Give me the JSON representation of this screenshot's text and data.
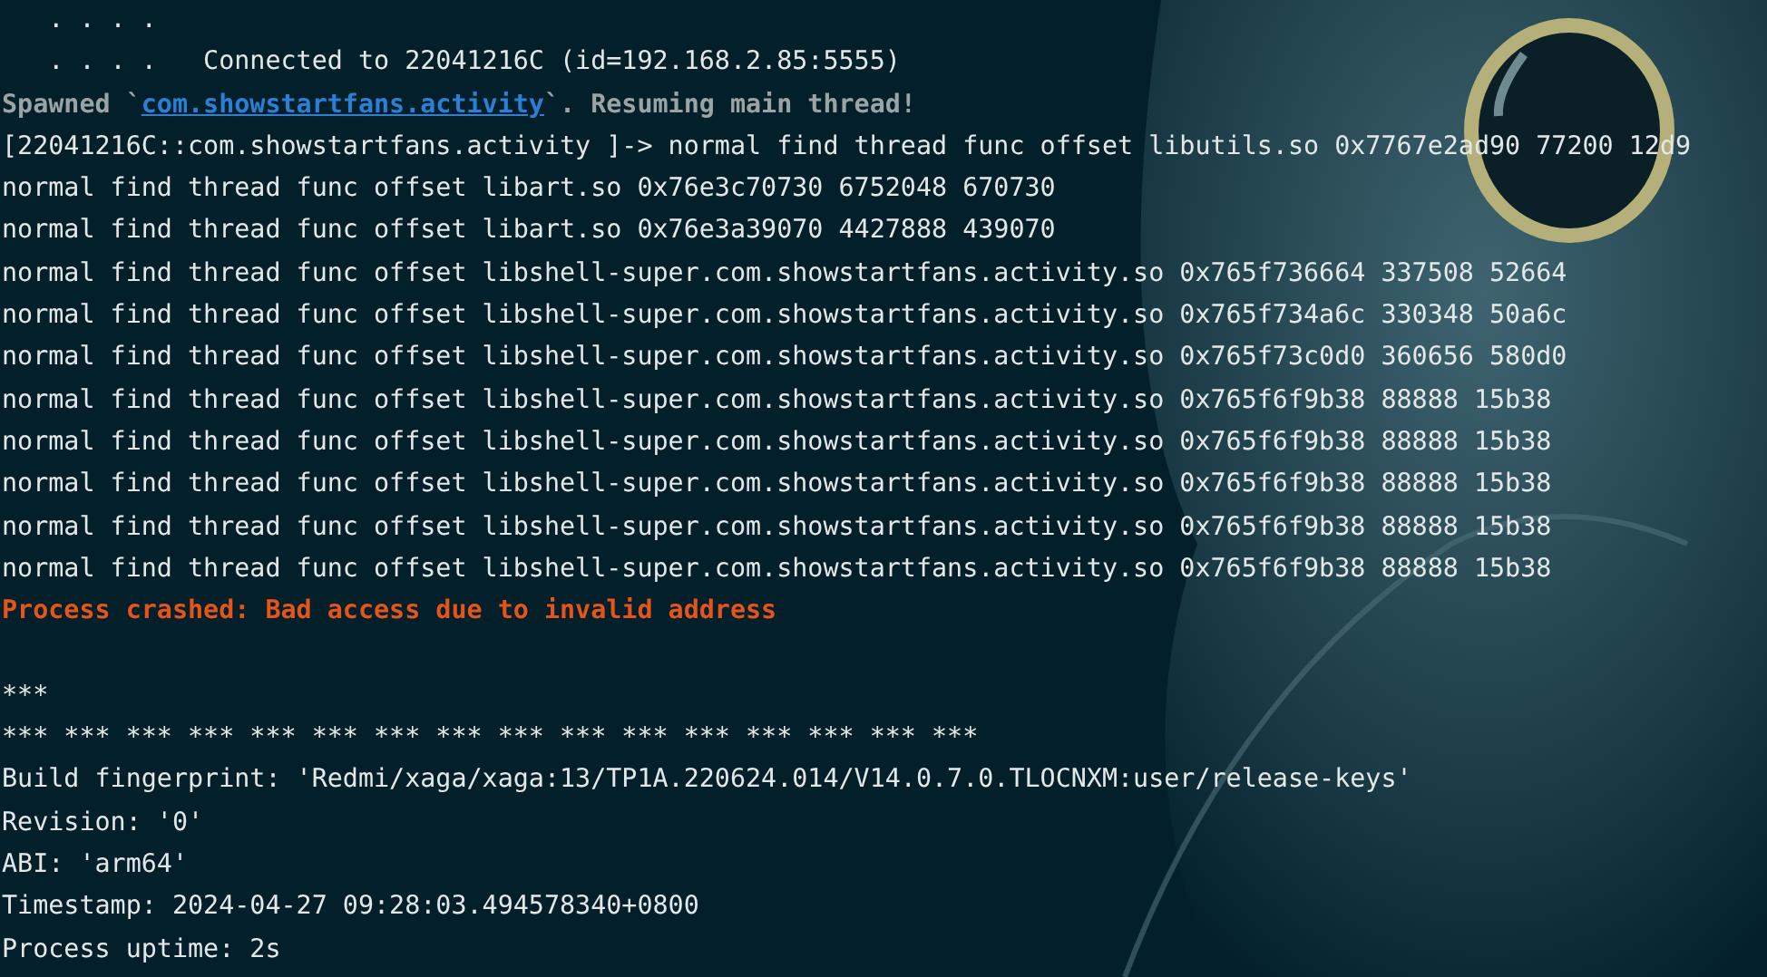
{
  "terminal": {
    "lines": [
      {
        "kind": "plain",
        "text": "   . . . ."
      },
      {
        "kind": "plain",
        "text": "   . . . .   Connected to 22041216C (id=192.168.2.85:5555)"
      },
      {
        "kind": "spawned",
        "prefix": "Spawned `",
        "link": "com.showstartfans.activity",
        "suffix": "`. Resuming main thread!"
      },
      {
        "kind": "plain",
        "text": "[22041216C::com.showstartfans.activity ]-> normal find thread func offset libutils.so 0x7767e2ad90 77200 12d9"
      },
      {
        "kind": "plain",
        "text": "normal find thread func offset libart.so 0x76e3c70730 6752048 670730"
      },
      {
        "kind": "plain",
        "text": "normal find thread func offset libart.so 0x76e3a39070 4427888 439070"
      },
      {
        "kind": "plain",
        "text": "normal find thread func offset libshell-super.com.showstartfans.activity.so 0x765f736664 337508 52664"
      },
      {
        "kind": "plain",
        "text": "normal find thread func offset libshell-super.com.showstartfans.activity.so 0x765f734a6c 330348 50a6c"
      },
      {
        "kind": "plain",
        "text": "normal find thread func offset libshell-super.com.showstartfans.activity.so 0x765f73c0d0 360656 580d0"
      },
      {
        "kind": "plain",
        "text": "normal find thread func offset libshell-super.com.showstartfans.activity.so 0x765f6f9b38 88888 15b38"
      },
      {
        "kind": "plain",
        "text": "normal find thread func offset libshell-super.com.showstartfans.activity.so 0x765f6f9b38 88888 15b38"
      },
      {
        "kind": "plain",
        "text": "normal find thread func offset libshell-super.com.showstartfans.activity.so 0x765f6f9b38 88888 15b38"
      },
      {
        "kind": "plain",
        "text": "normal find thread func offset libshell-super.com.showstartfans.activity.so 0x765f6f9b38 88888 15b38"
      },
      {
        "kind": "plain",
        "text": "normal find thread func offset libshell-super.com.showstartfans.activity.so 0x765f6f9b38 88888 15b38"
      },
      {
        "kind": "error",
        "text": "Process crashed: Bad access due to invalid address"
      },
      {
        "kind": "blank"
      },
      {
        "kind": "plain",
        "text": "***"
      },
      {
        "kind": "plain",
        "text": "*** *** *** *** *** *** *** *** *** *** *** *** *** *** *** ***"
      },
      {
        "kind": "plain",
        "text": "Build fingerprint: 'Redmi/xaga/xaga:13/TP1A.220624.014/V14.0.7.0.TLOCNXM:user/release-keys'"
      },
      {
        "kind": "plain",
        "text": "Revision: '0'"
      },
      {
        "kind": "plain",
        "text": "ABI: 'arm64'"
      },
      {
        "kind": "plain",
        "text": "Timestamp: 2024-04-27 09:28:03.494578340+0800"
      },
      {
        "kind": "plain",
        "text": "Process uptime: 2s"
      }
    ]
  }
}
